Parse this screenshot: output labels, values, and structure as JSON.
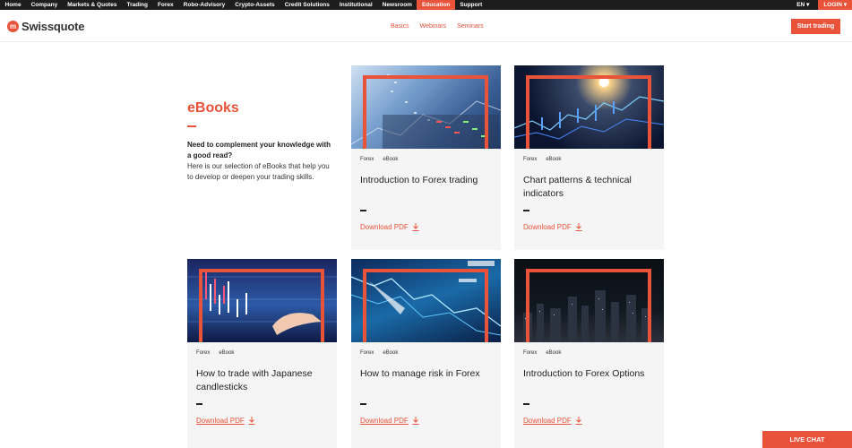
{
  "topnav": {
    "items": [
      "Home",
      "Company",
      "Markets & Quotes",
      "Trading",
      "Forex",
      "Robo-Advisory",
      "Crypto-Assets",
      "Credit Solutions",
      "Institutional",
      "Newsroom",
      "Education",
      "Support"
    ],
    "active_index": 10,
    "lang": "EN",
    "login": "LOGIN"
  },
  "header": {
    "logo_text": "Swissquote",
    "subnav": [
      "Basics",
      "Webinars",
      "Seminars"
    ],
    "start_label": "Start trading"
  },
  "intro": {
    "title": "eBooks",
    "lead": "Need to complement your knowledge with a good read?",
    "body": "Here is our selection of eBooks that help you to develop or deepen your trading skills."
  },
  "cards": [
    {
      "tag1": "Forex",
      "tag2": "eBook",
      "title": "Introduction to Forex trading",
      "download": "Download PDF"
    },
    {
      "tag1": "Forex",
      "tag2": "eBook",
      "title": "Chart patterns & technical indicators",
      "download": "Download PDF"
    },
    {
      "tag1": "Forex",
      "tag2": "eBook",
      "title": "How to trade with Japanese candlesticks",
      "download": "Download PDF"
    },
    {
      "tag1": "Forex",
      "tag2": "eBook",
      "title": "How to manage risk in Forex",
      "download": "Download PDF"
    },
    {
      "tag1": "Forex",
      "tag2": "eBook",
      "title": "Introduction to Forex Options",
      "download": "Download PDF"
    }
  ],
  "live_chat": "LIVE CHAT",
  "colors": {
    "accent": "#e8533a",
    "topbar": "#1d1d1d",
    "card_bg": "#f5f5f5"
  }
}
